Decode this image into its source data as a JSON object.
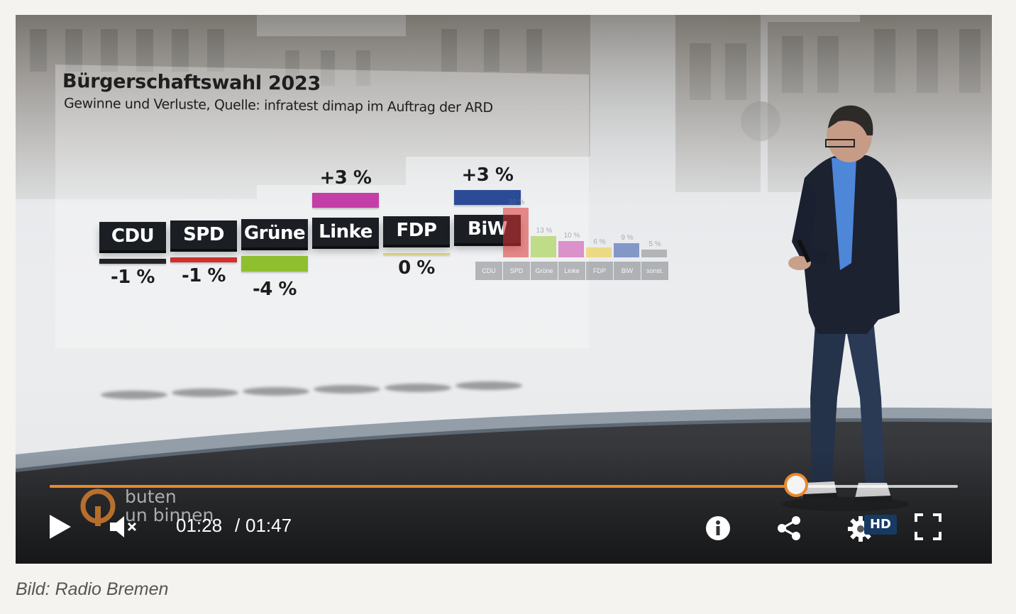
{
  "video": {
    "current_time": "01:28",
    "duration_separator": "/",
    "duration": "01:47",
    "progress_fraction": 0.822,
    "quality_badge": "HD",
    "accent_color": "#e9882f"
  },
  "brand": {
    "line1": "buten",
    "line2": "un binnen"
  },
  "chart_data": {
    "type": "bar",
    "title": "Bürgerschaftswahl 2023",
    "subtitle": "Gewinne und Verluste, Quelle: infratest dimap im Auftrag der ARD",
    "categories": [
      "CDU",
      "SPD",
      "Grüne",
      "Linke",
      "FDP",
      "BiW"
    ],
    "values": [
      -1,
      -1,
      -4,
      3,
      0,
      3
    ],
    "value_labels": [
      "-1 %",
      "-1 %",
      "-4 %",
      "+3 %",
      "0 %",
      "+3 %"
    ],
    "colors": [
      "#222222",
      "#d12f2a",
      "#8fbf2e",
      "#c33ea7",
      "#e2cf3a",
      "#2b4b96"
    ],
    "unit": "%"
  },
  "background_chart": {
    "categories": [
      "CDU",
      "SPD",
      "Grüne",
      "Linke",
      "FDP",
      "BiW",
      "sonst."
    ],
    "value_labels": [
      "",
      "30 %",
      "13 %",
      "10 %",
      "6 %",
      "9 %",
      "5 %"
    ]
  },
  "caption": "Bild: Radio Bremen"
}
